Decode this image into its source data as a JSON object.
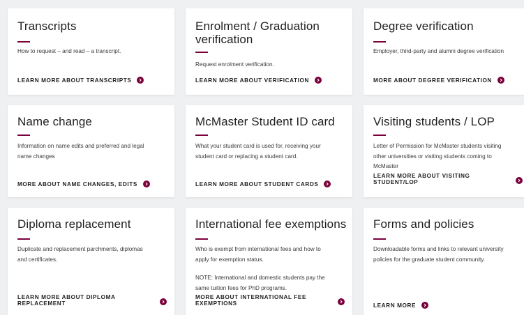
{
  "colors": {
    "accent": "#7a003c",
    "background": "#eef0f2",
    "card": "#ffffff"
  },
  "cards": [
    {
      "title": "Transcripts",
      "description": [
        "How to request – and read – a transcript."
      ],
      "link": "LEARN MORE ABOUT TRANSCRIPTS"
    },
    {
      "title_lines": [
        "Enrolment / Graduation",
        "verification"
      ],
      "description": [
        "Request enrolment verification."
      ],
      "link": "LEARN MORE ABOUT VERIFICATION"
    },
    {
      "title": "Degree verification",
      "description": [
        "Employer, third-party and alumni degree verification"
      ],
      "link": "MORE ABOUT DEGREE VERIFICATION"
    },
    {
      "title": "Name change",
      "description": [
        "Information on name edits and preferred and legal",
        "name changes"
      ],
      "link": "MORE ABOUT NAME CHANGES, EDITS"
    },
    {
      "title": "McMaster Student ID card",
      "description": [
        "What your student card is used for, receiving your",
        "student card or replacing a student card."
      ],
      "link": "LEARN MORE ABOUT STUDENT CARDS"
    },
    {
      "title": "Visiting students / LOP",
      "description": [
        "Letter of Permission for McMaster students visiting",
        "other universities or visiting students coming to",
        "McMaster"
      ],
      "link_lines": [
        "LEARN MORE ABOUT VISITING",
        "STUDENT/LOP"
      ]
    },
    {
      "title": "Diploma replacement",
      "description": [
        "Duplicate and replacement parchments, diplomas",
        "and certificates."
      ],
      "link_lines": [
        "LEARN MORE ABOUT DIPLOMA",
        "REPLACEMENT"
      ]
    },
    {
      "title": "International fee exemptions",
      "description": [
        "Who is exempt from international fees and how to",
        "apply for exemption status."
      ],
      "note": [
        "NOTE: International and domestic students pay the",
        "same tuition fees for PhD programs."
      ],
      "link_lines": [
        "MORE ABOUT INTERNATIONAL FEE",
        "EXEMPTIONS"
      ]
    },
    {
      "title": "Forms and policies",
      "description": [
        "Downloadable forms and links to relevant university",
        "policies for the graduate student community."
      ],
      "link": "LEARN MORE"
    }
  ]
}
